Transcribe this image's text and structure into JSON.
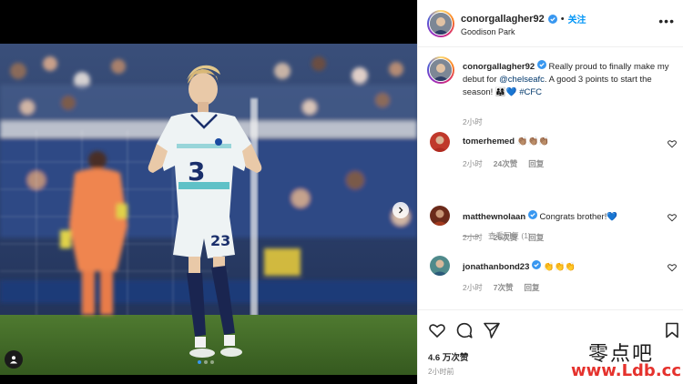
{
  "post": {
    "author": "conorgallagher92",
    "follow_label": "关注",
    "location": "Goodison Park",
    "more_label": "•••",
    "caption": {
      "user": "conorgallagher92",
      "text_before": "Really proud to finally make my debut for",
      "mention": "@chelseafc",
      "text_after": ". A good 3 points to start the season!",
      "emoji": "👨‍👩‍👧💙",
      "hashtag": "#CFC",
      "time": "2小时"
    },
    "likes": "4.6 万次赞",
    "posted": "2小时前"
  },
  "comments": [
    {
      "user": "tomerhemed",
      "text": "👏🏽👏🏽👏🏽",
      "time": "2小时",
      "likes": "24次赞",
      "reply": "回复"
    },
    {
      "user": "matthewnolaan",
      "text": "Congrats brother!💙",
      "time": "2小时",
      "likes": "26次赞",
      "reply": "回复"
    },
    {
      "user": "jonathanbond23",
      "text": "👏👏👏",
      "time": "2小时",
      "likes": "7次赞",
      "reply": "回复"
    }
  ],
  "view_replies": "查看回复 (1)",
  "colors": {
    "link": "#00376b",
    "follow": "#0095f6",
    "verified": "#3897f0",
    "muted": "#8e8e8e",
    "watermark_red": "#e5322d"
  },
  "photo": {
    "shirt_number": "23"
  },
  "watermark": {
    "chinese": "零点吧",
    "url": "www.Ldb.cc"
  },
  "icons": [
    "verified-icon",
    "heart-icon",
    "comment-icon",
    "share-icon",
    "bookmark-icon",
    "chevron-right-icon",
    "user-tag-icon",
    "more-icon"
  ]
}
